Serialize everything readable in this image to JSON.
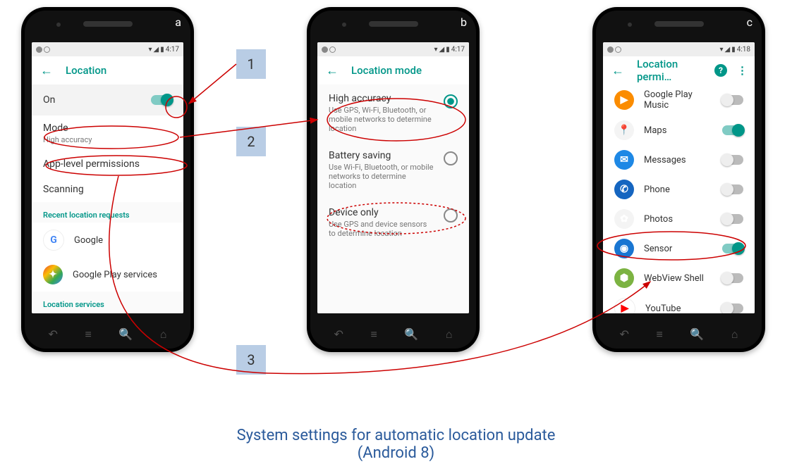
{
  "status": {
    "time_a": "4:17",
    "time_b": "4:17",
    "time_c": "4:18"
  },
  "labels": {
    "a": "a",
    "b": "b",
    "c": "c"
  },
  "steps": {
    "s1": "1",
    "s2": "2",
    "s3": "3"
  },
  "phone_a": {
    "title": "Location",
    "on_label": "On",
    "mode_title": "Mode",
    "mode_sub": "High accuracy",
    "applevel": "App-level permissions",
    "scanning": "Scanning",
    "section_recent": "Recent location requests",
    "app_google": "Google",
    "app_playservices": "Google Play services",
    "section_services": "Location services"
  },
  "phone_b": {
    "title": "Location mode",
    "opt1_title": "High accuracy",
    "opt1_sub": "Use GPS, Wi-Fi, Bluetooth, or mobile networks to determine location",
    "opt2_title": "Battery saving",
    "opt2_sub": "Use Wi-Fi, Bluetooth, or mobile networks to determine location",
    "opt3_title": "Device only",
    "opt3_sub": "Use GPS and device sensors to determine location"
  },
  "phone_c": {
    "title": "Location permi…",
    "apps": [
      {
        "name": "Google Play Music",
        "bg": "#fb8c00",
        "glyph": "▶",
        "on": false
      },
      {
        "name": "Maps",
        "bg": "#f4f4f4",
        "glyph": "📍",
        "on": true
      },
      {
        "name": "Messages",
        "bg": "#1e88e5",
        "glyph": "✉",
        "on": false
      },
      {
        "name": "Phone",
        "bg": "#1565c0",
        "glyph": "✆",
        "on": false
      },
      {
        "name": "Photos",
        "bg": "#f4f4f4",
        "glyph": "✿",
        "on": false
      },
      {
        "name": "Sensor",
        "bg": "#1976d2",
        "glyph": "◉",
        "on": true
      },
      {
        "name": "WebView Shell",
        "bg": "#7cb342",
        "glyph": "⬢",
        "on": false
      },
      {
        "name": "YouTube",
        "bg": "#fff",
        "glyph": "▶",
        "on": false
      }
    ]
  },
  "caption_line1": "System settings for automatic location update",
  "caption_line2": "(Android 8)"
}
